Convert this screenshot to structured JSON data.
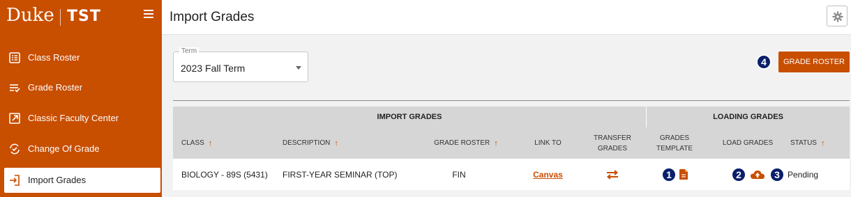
{
  "brand": {
    "name": "Duke",
    "product": "TST"
  },
  "sidebar": {
    "items": [
      {
        "label": "Class Roster",
        "icon": "class-roster-icon"
      },
      {
        "label": "Grade Roster",
        "icon": "grade-roster-icon"
      },
      {
        "label": "Classic Faculty Center",
        "icon": "external-link-icon"
      },
      {
        "label": "Change Of Grade",
        "icon": "change-grade-icon"
      },
      {
        "label": "Import Grades",
        "icon": "import-icon",
        "active": true
      }
    ]
  },
  "header": {
    "title": "Import Grades",
    "settings_icon": "gear-icon"
  },
  "term": {
    "label": "Term",
    "value": "2023 Fall Term"
  },
  "actions": {
    "grade_roster_label": "GRADE ROSTER"
  },
  "badges": [
    "1",
    "2",
    "3",
    "4"
  ],
  "table": {
    "groups": [
      "IMPORT GRADES",
      "LOADING GRADES"
    ],
    "headers": {
      "class": "CLASS",
      "description": "DESCRIPTION",
      "grade_roster": "GRADE ROSTER",
      "link_to": "LINK TO",
      "transfer_grades": "TRANSFER GRADES",
      "grades_template": "GRADES TEMPLATE",
      "load_grades": "LOAD GRADES",
      "status": "STATUS"
    },
    "rows": [
      {
        "class": "BIOLOGY - 89S (5431)",
        "description": "FIRST-YEAR SEMINAR (TOP)",
        "grade_roster": "FIN",
        "link_to": "Canvas",
        "status": "Pending"
      }
    ]
  },
  "colors": {
    "accent": "#c84e00",
    "badge": "#0a1f6b",
    "table_header": "#d6d6d6"
  }
}
